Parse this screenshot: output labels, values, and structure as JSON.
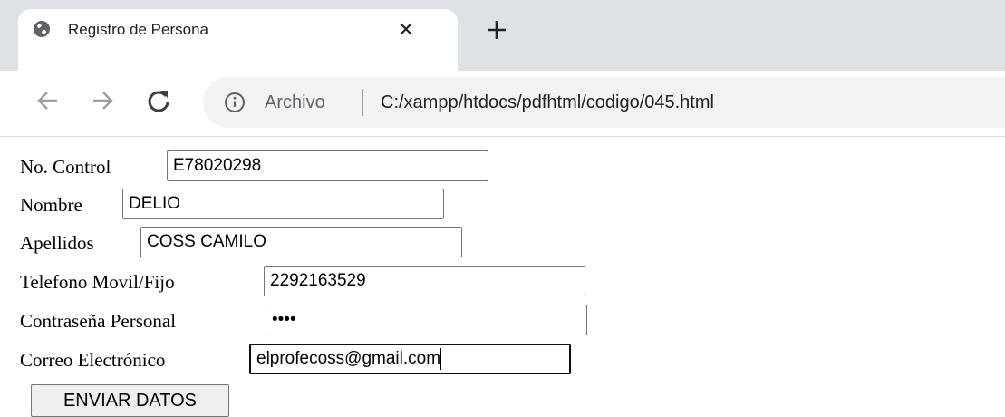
{
  "tab": {
    "title": "Registro de Persona"
  },
  "addressbar": {
    "scheme_label": "Archivo",
    "url": "C:/xampp/htdocs/pdfhtml/codigo/045.html"
  },
  "form": {
    "fields": [
      {
        "label": "No. Control",
        "value": "E78020298"
      },
      {
        "label": "Nombre",
        "value": "DELIO"
      },
      {
        "label": "Apellidos",
        "value": "COSS CAMILO"
      },
      {
        "label": "Telefono Movil/Fijo",
        "value": "2292163529"
      },
      {
        "label": "Contraseña Personal",
        "value": "••••"
      },
      {
        "label": "Correo Electrónico",
        "value": "elprofecoss@gmail.com"
      }
    ],
    "submit_label": "ENVIAR DATOS"
  }
}
